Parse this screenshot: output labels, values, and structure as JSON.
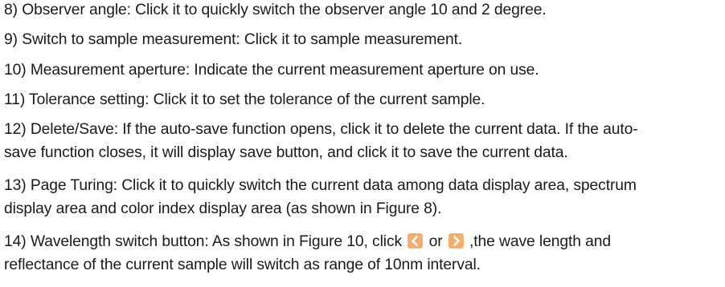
{
  "items": [
    {
      "text": "8) Observer angle: Click it to quickly switch the observer angle 10 and 2 degree."
    },
    {
      "text": "9) Switch to sample measurement: Click it to sample measurement."
    },
    {
      "text": "10) Measurement aperture: Indicate the current measurement aperture on use."
    },
    {
      "text": "11) Tolerance setting: Click it to set the tolerance of the current sample."
    },
    {
      "line1": "12) Delete/Save: If the auto-save function opens, click it to delete the current data. If the auto-",
      "line2": "save function closes, it will display save button, and click it to save the current data."
    },
    {
      "line1": "13) Page Turing: Click it to quickly switch the current data among data display area, spectrum",
      "line2": "display area and color index display area (as shown in Figure 8)."
    },
    {
      "line1_a": "14) Wavelength switch button: As shown in Figure 10, click ",
      "line1_or": " or ",
      "line1_b": " ,the wave length and",
      "line2": "reflectance of the current sample will switch as range of 10nm interval.",
      "icon_left": "chevron-left-icon",
      "icon_right": "chevron-right-icon",
      "icon_color": "#f3ad6c"
    }
  ]
}
